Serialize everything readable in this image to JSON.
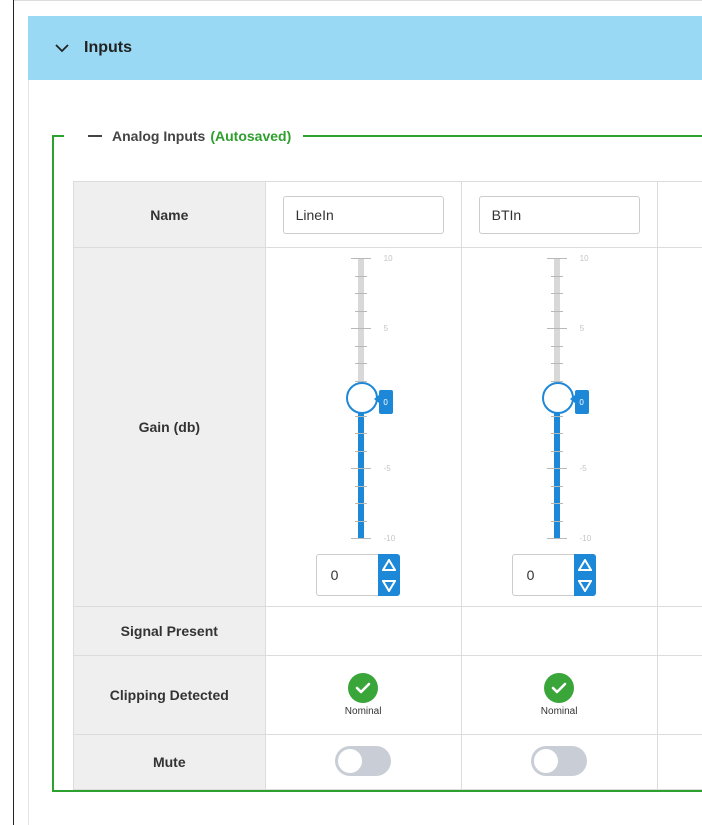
{
  "accordion": {
    "title": "Inputs",
    "icon": "chevron-down-icon",
    "color": "#9ad9f4"
  },
  "section": {
    "title": "Analog Inputs",
    "status": "(Autosaved)",
    "accent": "#2ea02e",
    "collapse_icon": "minus-icon"
  },
  "rows": {
    "name": "Name",
    "gain": "Gain (db)",
    "signal": "Signal Present",
    "clipping": "Clipping Detected",
    "mute": "Mute"
  },
  "slider_ticks": [
    "10",
    "5",
    "0",
    "-5",
    "-10"
  ],
  "channels": [
    {
      "name": "LineIn",
      "gain_value": "0",
      "gain_flag": "0",
      "gain_min": -10,
      "gain_max": 10,
      "clipping_status": "Nominal",
      "muted": false
    },
    {
      "name": "BTIn",
      "gain_value": "0",
      "gain_flag": "0",
      "gain_min": -10,
      "gain_max": 10,
      "clipping_status": "Nominal",
      "muted": false
    }
  ],
  "colors": {
    "slider": "#1e88d8",
    "check": "#3aa63a",
    "toggle_off": "#c9ced6"
  }
}
